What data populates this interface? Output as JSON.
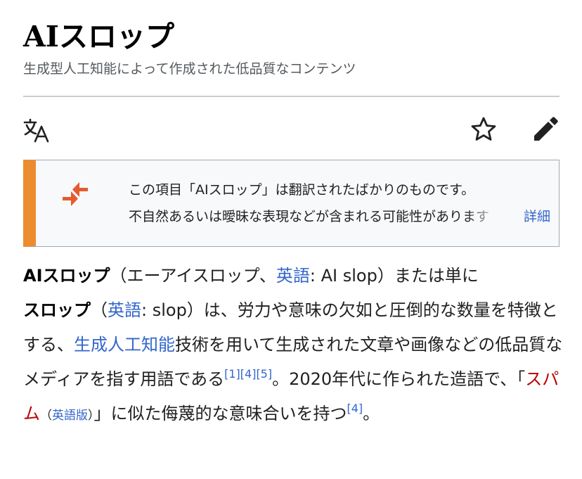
{
  "header": {
    "title": "AIスロップ",
    "subtitle": "生成型人工知能によって作成された低品質なコンテンツ"
  },
  "toolbar": {
    "language_icon": "language-icon",
    "watch_icon": "star-icon",
    "edit_icon": "pencil-icon"
  },
  "notice": {
    "accent_color": "#ed8c2e",
    "icon": "translation-arrows-icon",
    "line1": "この項目「AIスロップ」は翻訳されたばかりのものです。",
    "line2": "不自然あるいは曖昧な表現などが含まれる可能性があります",
    "more_label": "詳細"
  },
  "article": {
    "term_bold": "AIスロップ",
    "p1": "（エーアイスロップ、",
    "english_link": "英語",
    "p2": ": AI slop）または単に",
    "term2_bold": "スロップ",
    "p3": "（",
    "english_link2": "英語",
    "p4": ": slop）は、労力や意味の欠如と圧倒的な数量を特徴とする、",
    "genai_link": "生成人工知能",
    "p5": "技術を用いて生成された文章や画像などの低品質なメディアを指す用語である",
    "ref1": "[1]",
    "ref4": "[4]",
    "ref5": "[5]",
    "p6": "。2020年代に作られた造語で、「",
    "spam_link": "スパム",
    "ill_open": "（",
    "ill_link": "英語版",
    "ill_close": "）",
    "p7": "」に似た侮蔑的な意味合いを持つ",
    "ref4b": "[4]",
    "p8": "。"
  },
  "colors": {
    "link": "#3366cc",
    "redlink": "#ba0000",
    "text": "#202122",
    "subtle": "#54595d"
  }
}
